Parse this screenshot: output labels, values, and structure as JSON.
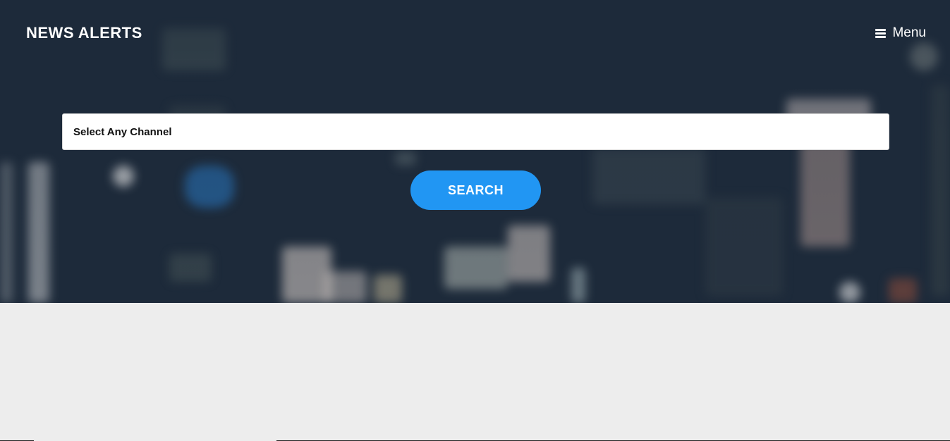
{
  "header": {
    "brand": "NEWS ALERTS",
    "menu_label": "Menu"
  },
  "search_form": {
    "channel_select_value": "Select Any Channel",
    "search_button_label": "SEARCH"
  },
  "colors": {
    "hero_background": "#1d2a3a",
    "page_background": "#ededed",
    "accent": "#2196f3"
  }
}
